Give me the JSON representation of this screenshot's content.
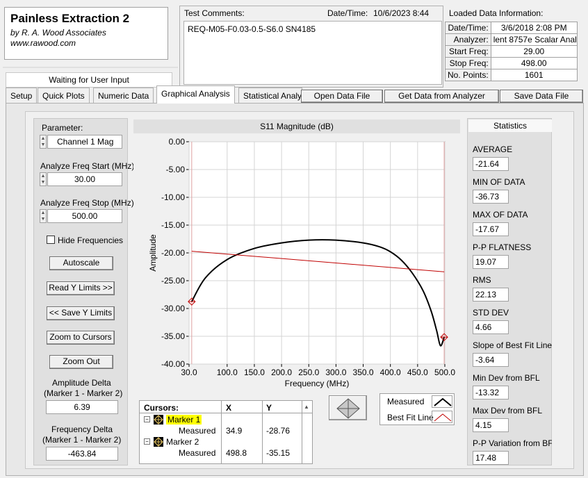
{
  "app": {
    "title": "Painless Extraction 2",
    "subtitle": "by R. A. Wood Associates",
    "url": "www.rawood.com",
    "status": "Waiting for User Input"
  },
  "comments": {
    "label": "Test Comments:",
    "datetime_label": "Date/Time:",
    "datetime_value": "10/6/2023  8:44",
    "text": "REQ-M05-F0.03-0.5-S6.0  SN4185"
  },
  "loaded_info": {
    "label": "Loaded Data Information:",
    "rows": [
      {
        "key": "Date/Time:",
        "value": "3/6/2018 2:08 PM"
      },
      {
        "key": "Analyzer:",
        "value": "lent 8757e Scalar Analy"
      },
      {
        "key": "Start Freq:",
        "value": "29.00"
      },
      {
        "key": "Stop Freq:",
        "value": "498.00"
      },
      {
        "key": "No. Points:",
        "value": "1601"
      }
    ]
  },
  "tabs": [
    {
      "label": "Setup"
    },
    {
      "label": "Quick Plots"
    },
    {
      "label": "Numeric Data"
    },
    {
      "label": "Graphical Analysis"
    },
    {
      "label": "Statistical Analy"
    }
  ],
  "top_buttons": {
    "open": "Open Data File",
    "get": "Get Data from Analyzer",
    "save": "Save Data File"
  },
  "controls": {
    "parameter_label": "Parameter:",
    "parameter_value": "Channel 1 Mag",
    "start_label": "Analyze Freq Start (MHz)",
    "start_value": "30.00",
    "stop_label": "Analyze Freq Stop (MHz)",
    "stop_value": "500.00",
    "hide_freq_label": "Hide Frequencies",
    "autoscale": "Autoscale",
    "read_y": "Read Y Limits >>",
    "save_y": "<< Save Y Limits",
    "zoom_cursors": "Zoom to Cursors",
    "zoom_out": "Zoom Out",
    "amp_delta_label1": "Amplitude Delta",
    "amp_delta_label2": "(Marker 1 - Marker 2)",
    "amp_delta_value": "6.39",
    "freq_delta_label1": "Frequency Delta",
    "freq_delta_label2": "(Marker 1 - Marker 2)",
    "freq_delta_value": "-463.84"
  },
  "chart_data": {
    "type": "line",
    "title": "S11 Magnitude (dB)",
    "xlabel": "Frequency (MHz)",
    "ylabel": "Amplitude",
    "xlim": [
      30,
      500
    ],
    "ylim": [
      -40,
      0
    ],
    "x_ticks": [
      "30.0",
      "100.0",
      "150.0",
      "200.0",
      "250.0",
      "300.0",
      "350.0",
      "400.0",
      "450.0",
      "500.0"
    ],
    "y_ticks": [
      "0.00",
      "-5.00",
      "-10.00",
      "-15.00",
      "-20.00",
      "-25.00",
      "-30.00",
      "-35.00",
      "-40.00"
    ],
    "series": [
      {
        "name": "Measured",
        "color": "#000000",
        "x": [
          34.9,
          60,
          100,
          150,
          200,
          250,
          300,
          350,
          380,
          400,
          420,
          440,
          460,
          475,
          485,
          492,
          498.8
        ],
        "y": [
          -28.76,
          -24.5,
          -21.2,
          -19.2,
          -18.2,
          -17.7,
          -17.7,
          -18.2,
          -18.9,
          -19.8,
          -21.3,
          -23.6,
          -26.8,
          -30.5,
          -34,
          -36.7,
          -35.15
        ]
      },
      {
        "name": "Best Fit Line",
        "color": "#c00000",
        "x": [
          34.9,
          498.8
        ],
        "y": [
          -19.7,
          -23.4
        ]
      }
    ],
    "markers": [
      {
        "x": 34.9,
        "y": -28.76
      },
      {
        "x": 498.8,
        "y": -35.15
      }
    ]
  },
  "statistics": {
    "title": "Statistics",
    "items": [
      {
        "label": "AVERAGE",
        "value": "-21.64"
      },
      {
        "label": "MIN OF DATA",
        "value": "-36.73"
      },
      {
        "label": "MAX OF DATA",
        "value": "-17.67"
      },
      {
        "label": "P-P FLATNESS",
        "value": "19.07"
      },
      {
        "label": "RMS",
        "value": "22.13"
      },
      {
        "label": "STD DEV",
        "value": "4.66"
      },
      {
        "label": "Slope of Best Fit Line",
        "value": "-3.64"
      },
      {
        "label": "Min Dev from BFL",
        "value": "-13.32"
      },
      {
        "label": "Max Dev from BFL",
        "value": "4.15"
      },
      {
        "label": "P-P Variation from BF",
        "value": "17.48"
      }
    ]
  },
  "cursors": {
    "header": [
      "Cursors:",
      "X",
      "Y"
    ],
    "rows": [
      {
        "name": "Marker 1",
        "sub": "Measured",
        "x": "34.9",
        "y": "-28.76"
      },
      {
        "name": "Marker 2",
        "sub": "Measured",
        "x": "498.8",
        "y": "-35.15"
      }
    ]
  },
  "legend": {
    "items": [
      {
        "label": "Measured",
        "color": "#000000"
      },
      {
        "label": "Best Fit Line",
        "color": "#c00000"
      }
    ]
  }
}
